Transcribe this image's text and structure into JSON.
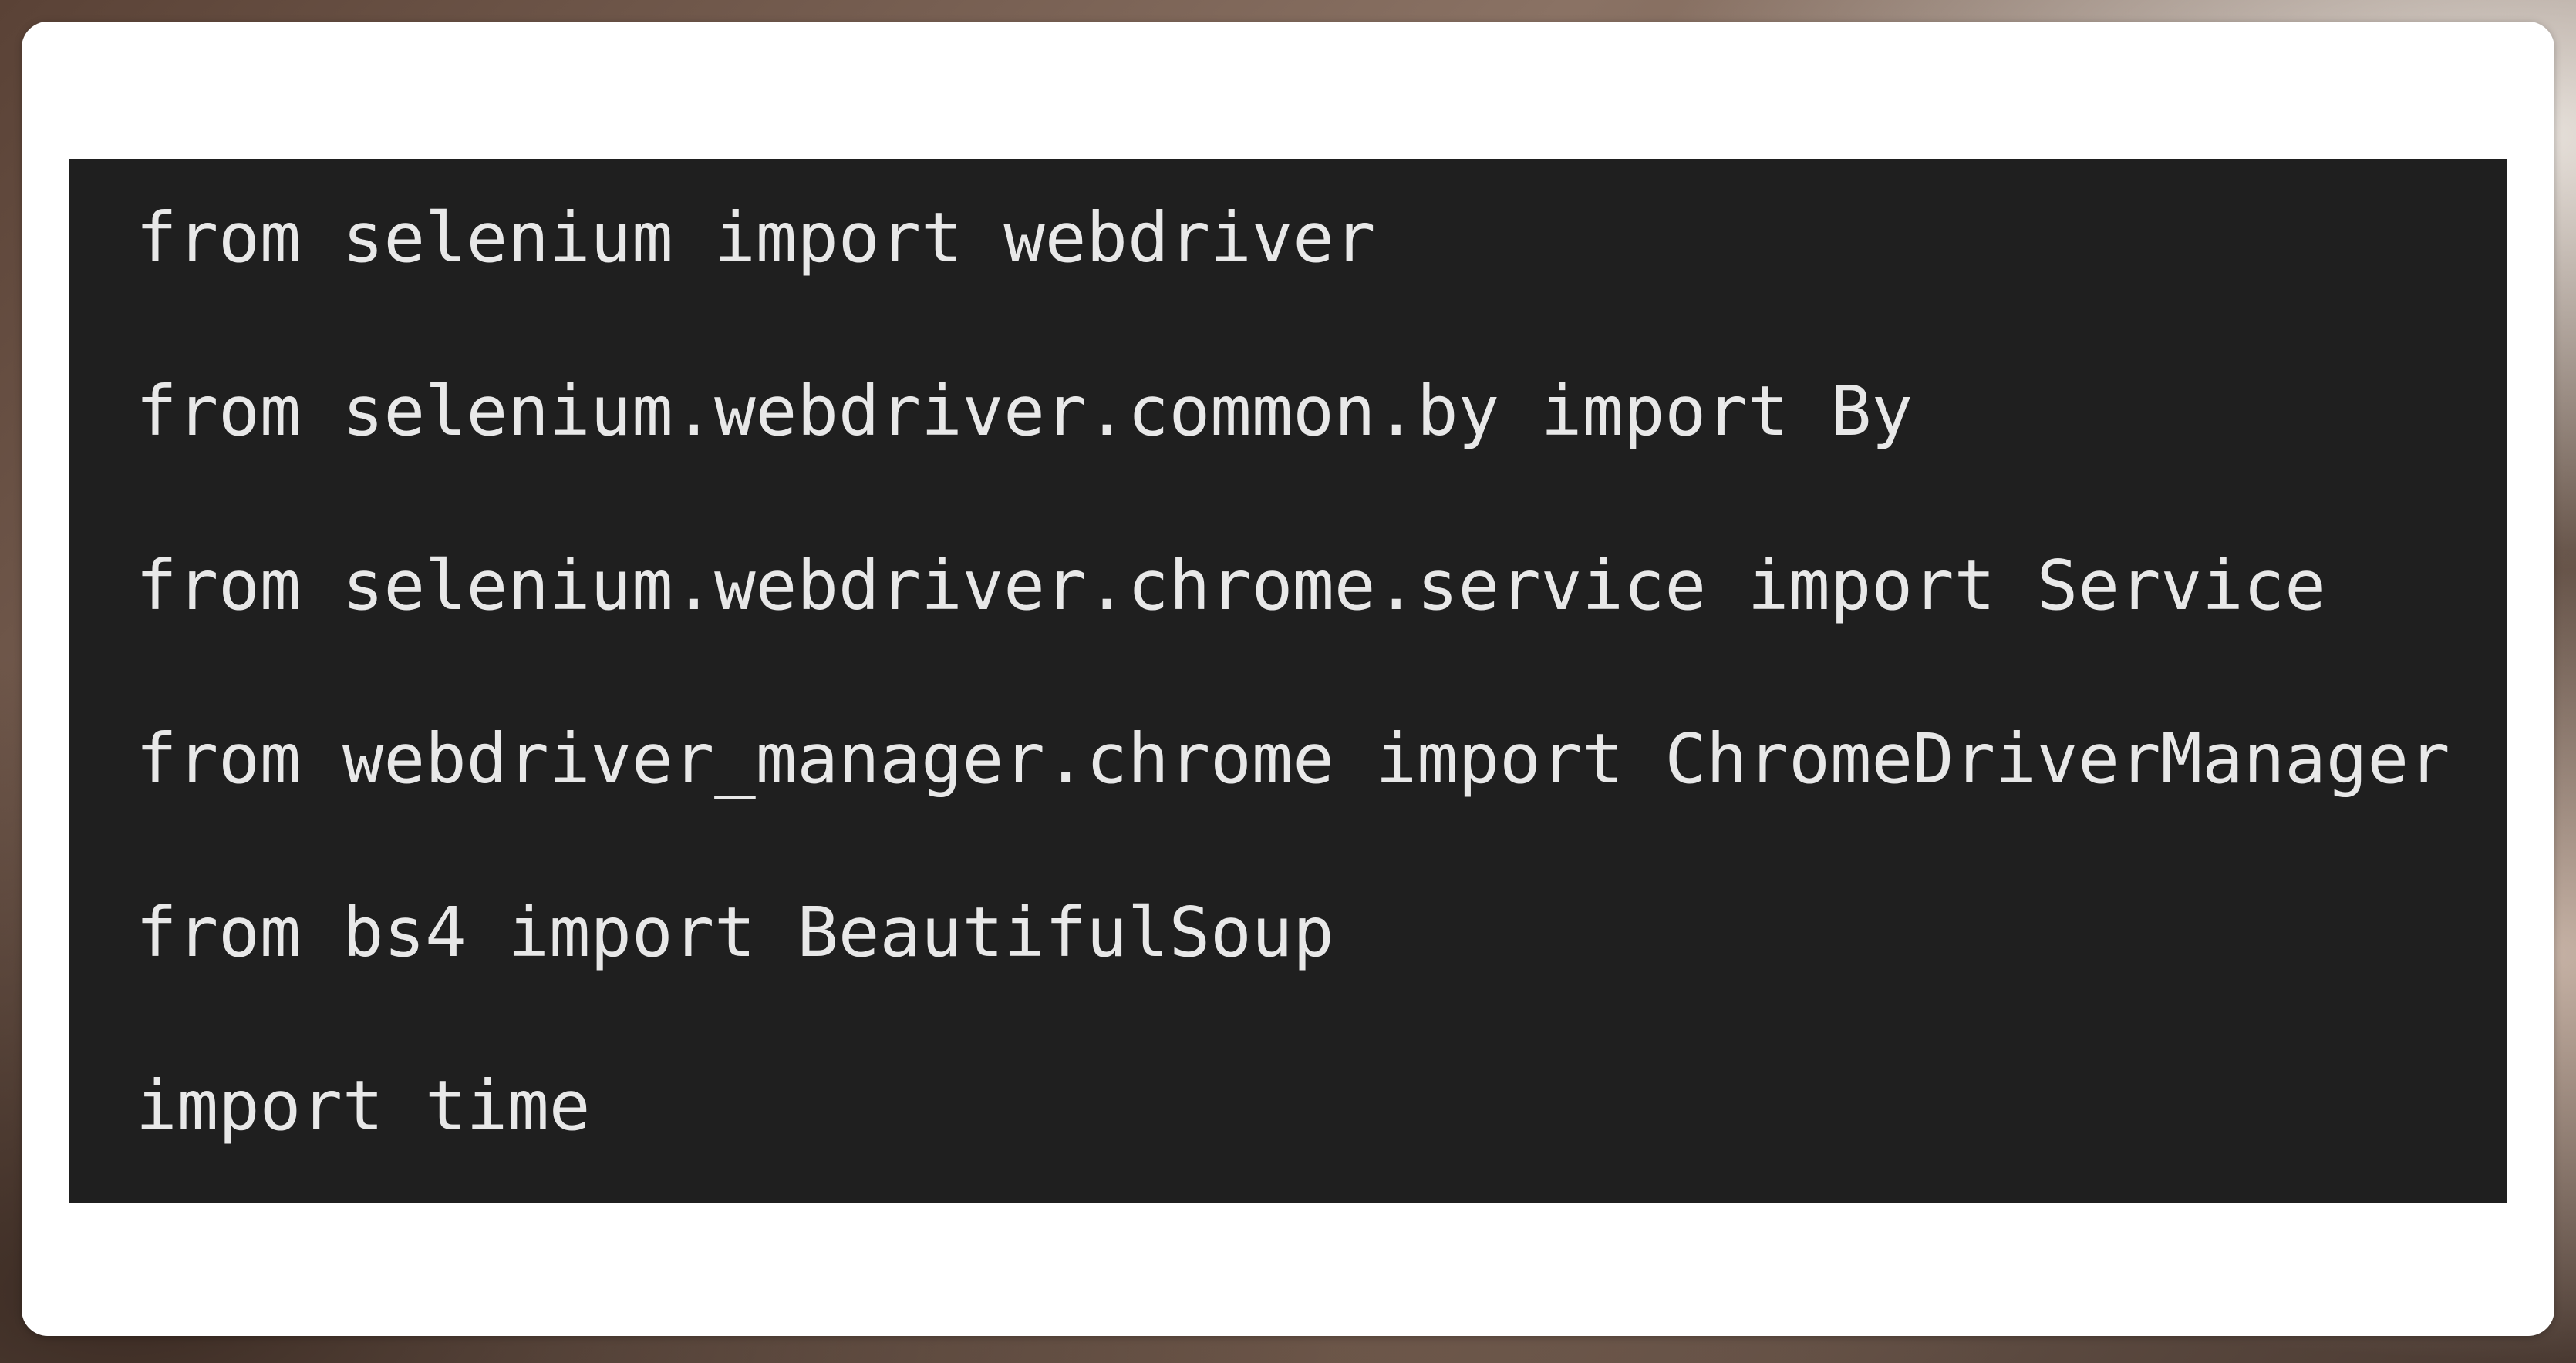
{
  "code": {
    "lines": [
      "from selenium import webdriver",
      "from selenium.webdriver.common.by import By",
      "from selenium.webdriver.chrome.service import Service",
      "from webdriver_manager.chrome import ChromeDriverManager",
      "from bs4 import BeautifulSoup",
      "import time"
    ]
  },
  "colors": {
    "code_background": "#1f1f1f",
    "code_text": "#e8e8e8",
    "card_background": "#ffffff"
  }
}
